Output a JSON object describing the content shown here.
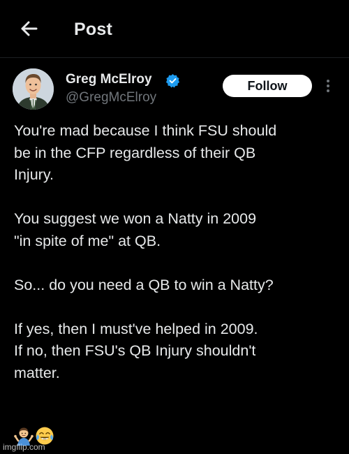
{
  "header": {
    "title": "Post",
    "back_icon": "arrow-left-icon"
  },
  "author": {
    "name": "Greg McElroy",
    "handle": "@GregMcElroy",
    "verified_icon": "verified-badge-icon",
    "badge_color": "#1d9bf0"
  },
  "actions": {
    "follow_label": "Follow",
    "more_icon": "more-vertical-icon"
  },
  "tweet": {
    "paragraphs": [
      [
        "You're mad because I think FSU should",
        "be in the CFP regardless of their QB",
        "Injury."
      ],
      [
        "You suggest we won a Natty in 2009",
        "\"in spite of me\" at QB."
      ],
      [
        "So... do you need a QB to win a Natty?"
      ],
      [
        "If yes, then I must've helped in 2009.",
        "If no, then FSU's QB Injury shouldn't",
        "matter."
      ]
    ],
    "emojis": [
      "person-shrugging-emoji",
      "face-with-tears-of-joy-emoji"
    ]
  },
  "watermark": "imgflip.com",
  "colors": {
    "background": "#000000",
    "text": "#e7e9ea",
    "secondary_text": "#71767b",
    "button_bg": "#ffffff"
  }
}
